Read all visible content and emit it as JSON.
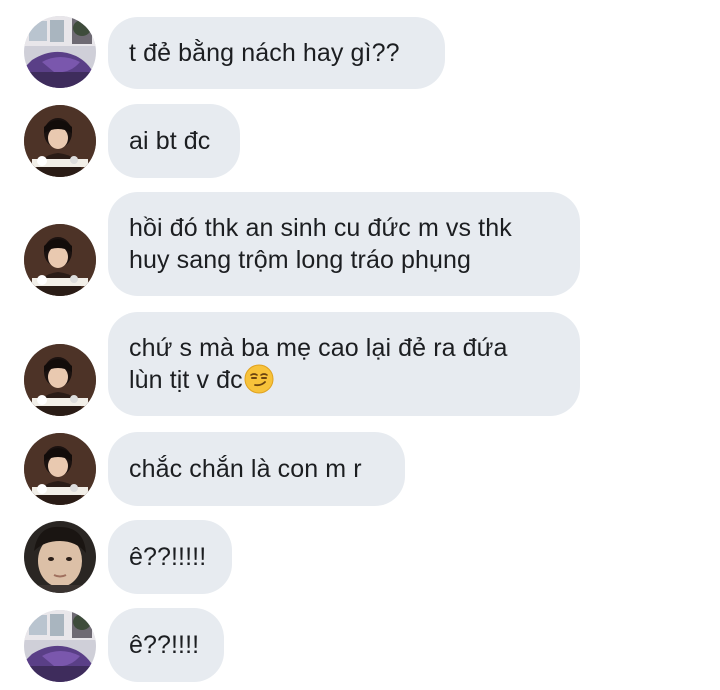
{
  "messages": [
    {
      "sender": "avatar-a",
      "text": "t đẻ bằng nách hay gì??"
    },
    {
      "sender": "avatar-b",
      "text": "ai bt đc"
    },
    {
      "sender": "avatar-b",
      "text": "hồi đó thk an sinh cu đức m vs thk\nhuy sang trộm long tráo phụng"
    },
    {
      "sender": "avatar-b",
      "text": "chứ s mà ba mẹ cao lại đẻ ra đứa\nlùn tịt v đc",
      "emoji": "smirking-face-emoji"
    },
    {
      "sender": "avatar-b",
      "text": "chắc chắn là con m r"
    },
    {
      "sender": "avatar-c",
      "text": "ê??!!!!!"
    },
    {
      "sender": "avatar-a",
      "text": "ê??!!!!"
    }
  ]
}
